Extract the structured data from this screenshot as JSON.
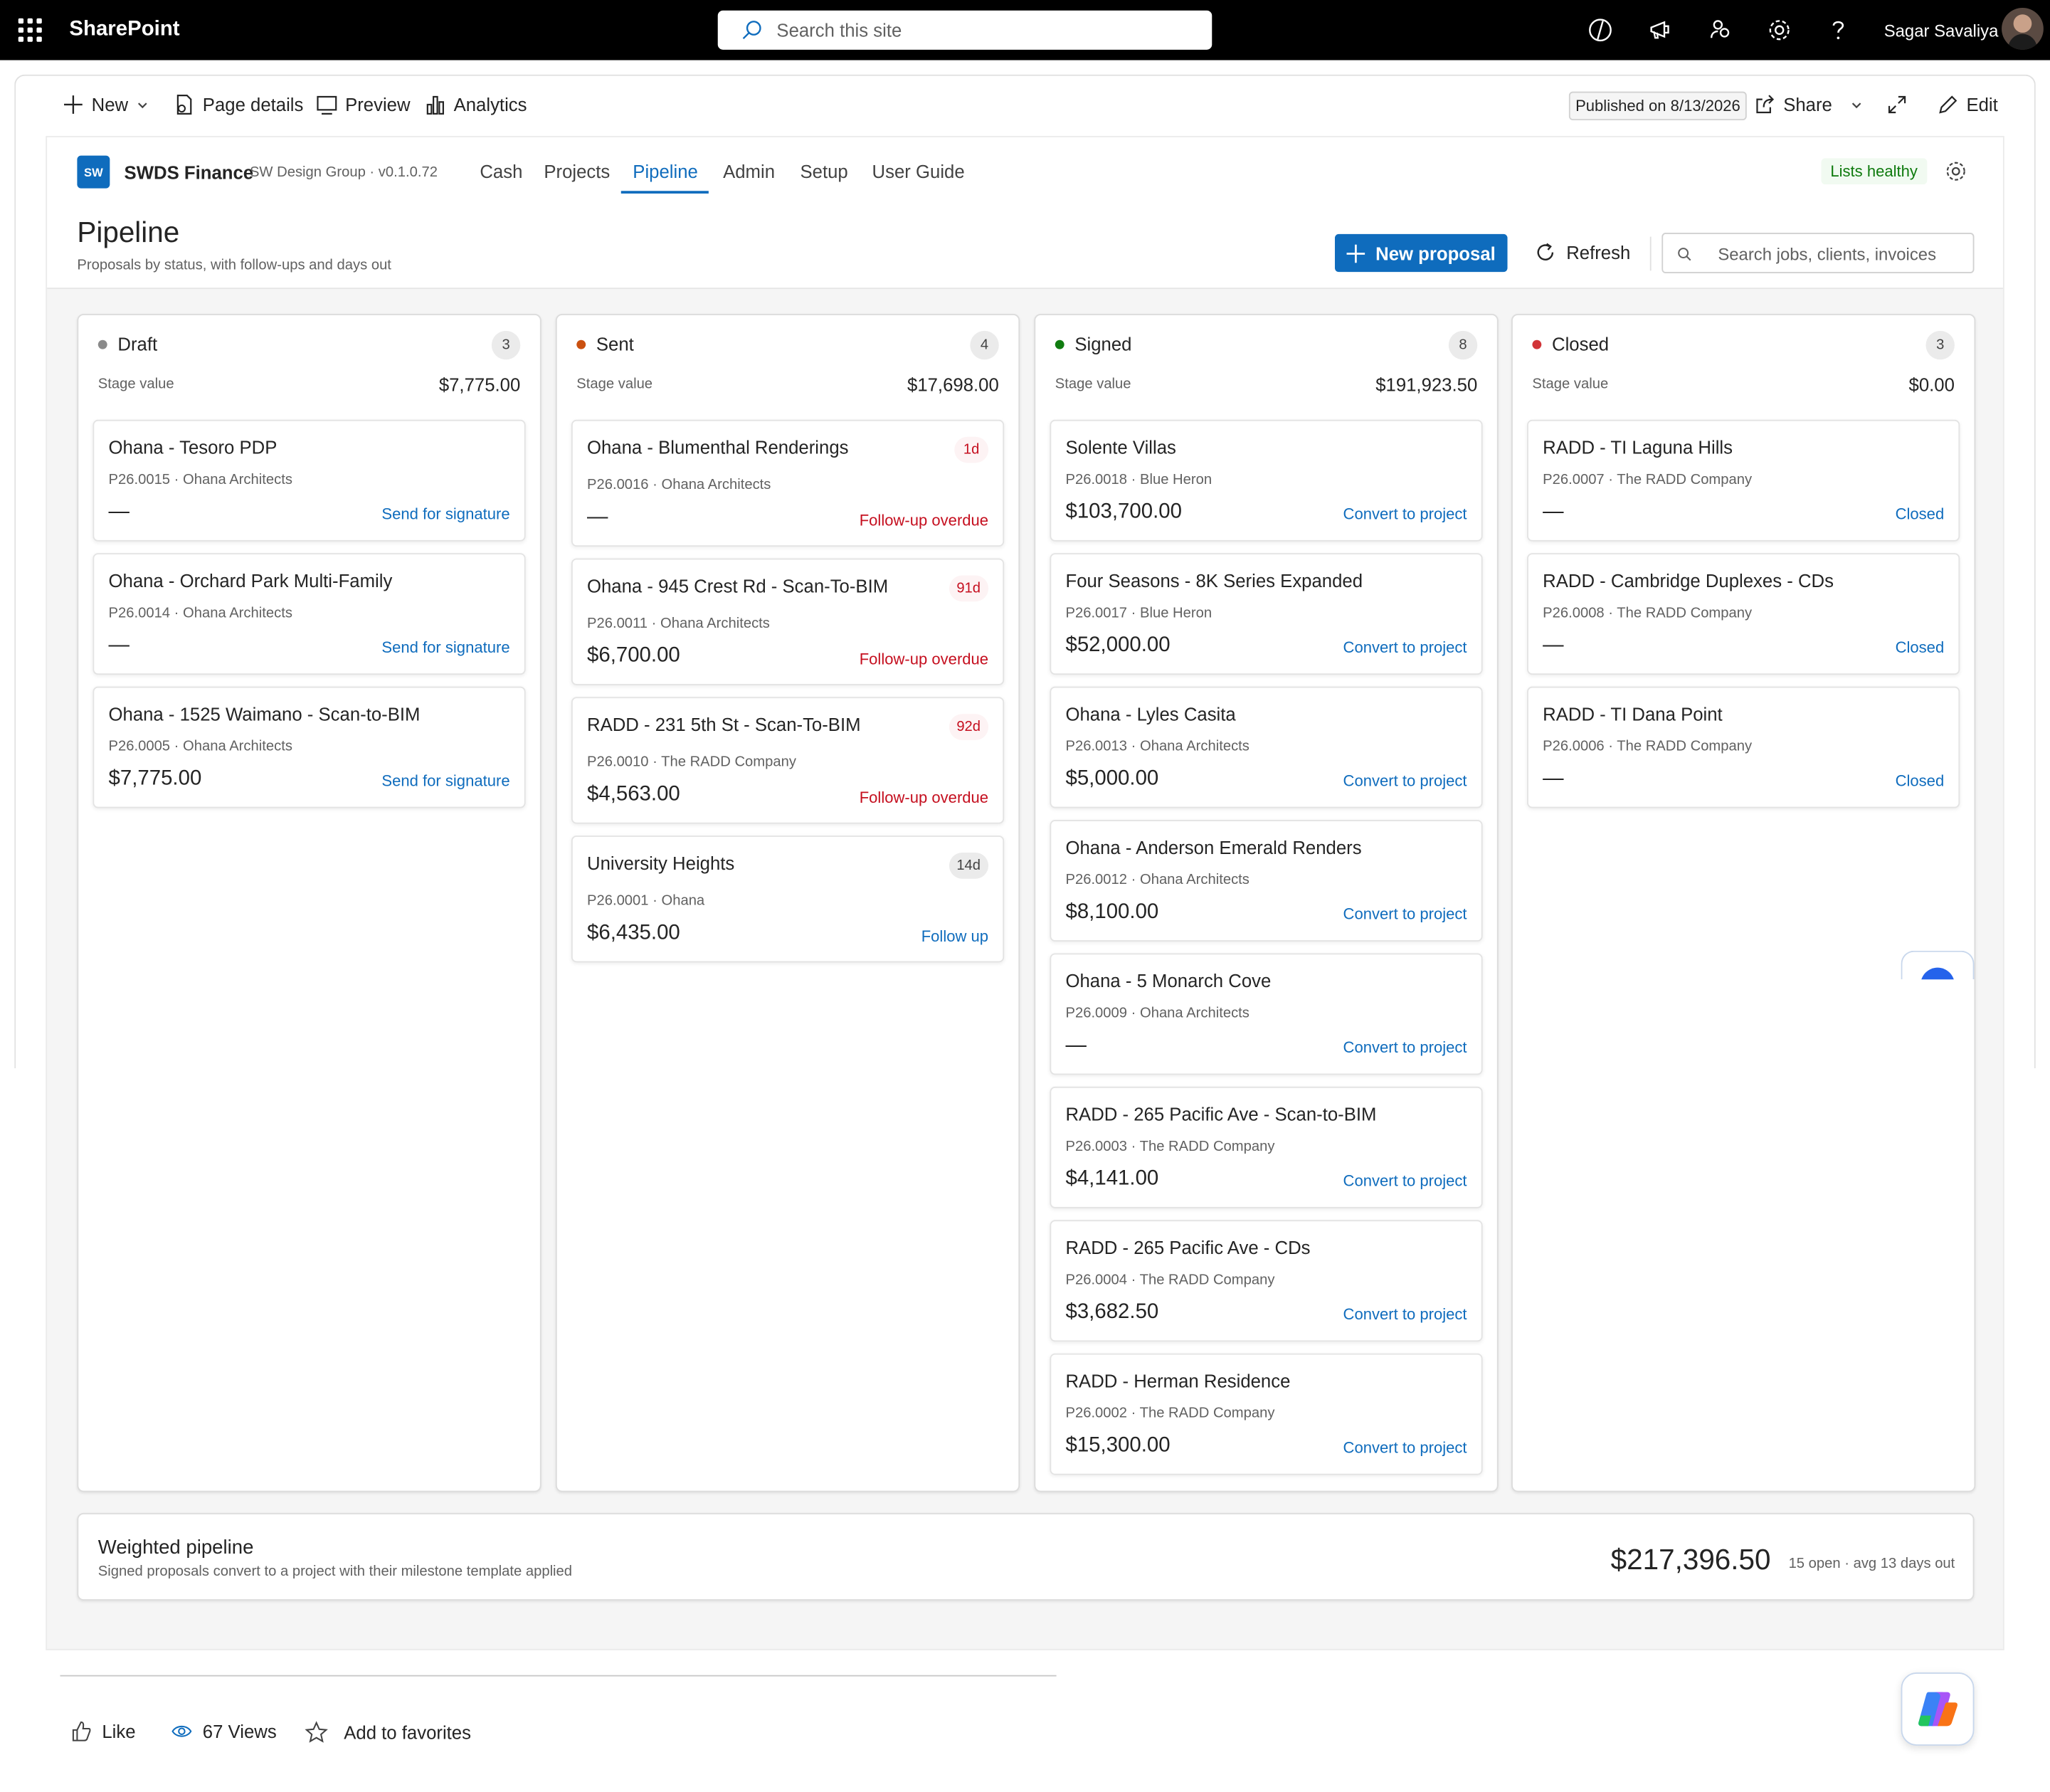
{
  "suite": {
    "brand": "SharePoint",
    "search_placeholder": "Search this site",
    "user_name": "Sagar Savaliya"
  },
  "command_bar": {
    "new_label": "New",
    "page_details_label": "Page details",
    "preview_label": "Preview",
    "analytics_label": "Analytics",
    "published_label": "Published on 8/13/2026",
    "share_label": "Share",
    "edit_label": "Edit"
  },
  "app": {
    "logo_text": "SW",
    "name": "SWDS Finance",
    "subtitle": "SW Design Group · v0.1.0.72",
    "tabs": [
      "Cash",
      "Projects",
      "Pipeline",
      "Admin",
      "Setup",
      "User Guide"
    ],
    "active_tab": "Pipeline",
    "status_badge": "Lists healthy",
    "accent_color": "#0f6cbd"
  },
  "page": {
    "title": "Pipeline",
    "subtitle": "Proposals by status, with follow-ups and days out",
    "new_proposal_label": "New proposal",
    "refresh_label": "Refresh",
    "search_placeholder": "Search jobs, clients, invoices"
  },
  "columns": [
    {
      "title": "Draft",
      "count": "3",
      "dot_color": "#8a8a8a",
      "stage_label": "Stage value",
      "stage_value": "$7,775.00",
      "cards": [
        {
          "title": "Ohana - Tesoro PDP",
          "meta": "P26.0015 · Ohana Architects",
          "amount": "—",
          "action": "Send for signature"
        },
        {
          "title": "Ohana - Orchard Park Multi-Family",
          "meta": "P26.0014 · Ohana Architects",
          "amount": "—",
          "action": "Send for signature"
        },
        {
          "title": "Ohana - 1525 Waimano - Scan-to-BIM",
          "meta": "P26.0005 · Ohana Architects",
          "amount": "$7,775.00",
          "action": "Send for signature"
        }
      ]
    },
    {
      "title": "Sent",
      "count": "4",
      "dot_color": "#ca5010",
      "stage_label": "Stage value",
      "stage_value": "$17,698.00",
      "cards": [
        {
          "title": "Ohana - Blumenthal Renderings",
          "meta": "P26.0016 · Ohana Architects",
          "amount": "—",
          "action": "Follow-up overdue",
          "badge": "1d"
        },
        {
          "title": "Ohana - 945 Crest Rd - Scan-To-BIM",
          "meta": "P26.0011 · Ohana Architects",
          "amount": "$6,700.00",
          "action": "Follow-up overdue",
          "badge": "91d"
        },
        {
          "title": "RADD - 231 5th St - Scan-To-BIM",
          "meta": "P26.0010 · The RADD Company",
          "amount": "$4,563.00",
          "action": "Follow-up overdue",
          "badge": "92d"
        },
        {
          "title": "University Heights",
          "meta": "P26.0001 · Ohana",
          "amount": "$6,435.00",
          "action": "Follow up",
          "badge": "14d"
        }
      ]
    },
    {
      "title": "Signed",
      "count": "8",
      "dot_color": "#107c10",
      "stage_label": "Stage value",
      "stage_value": "$191,923.50",
      "cards": [
        {
          "title": "Solente Villas",
          "meta": "P26.0018 · Blue Heron",
          "amount": "$103,700.00",
          "action": "Convert to project"
        },
        {
          "title": "Four Seasons - 8K Series Expanded",
          "meta": "P26.0017 · Blue Heron",
          "amount": "$52,000.00",
          "action": "Convert to project"
        },
        {
          "title": "Ohana - Lyles Casita",
          "meta": "P26.0013 · Ohana Architects",
          "amount": "$5,000.00",
          "action": "Convert to project"
        },
        {
          "title": "Ohana - Anderson Emerald Renders",
          "meta": "P26.0012 · Ohana Architects",
          "amount": "$8,100.00",
          "action": "Convert to project"
        },
        {
          "title": "Ohana - 5 Monarch Cove",
          "meta": "P26.0009 · Ohana Architects",
          "amount": "—",
          "action": "Convert to project"
        },
        {
          "title": "RADD - 265 Pacific Ave - Scan-to-BIM",
          "meta": "P26.0003 · The RADD Company",
          "amount": "$4,141.00",
          "action": "Convert to project"
        },
        {
          "title": "RADD - 265 Pacific Ave - CDs",
          "meta": "P26.0004 · The RADD Company",
          "amount": "$3,682.50",
          "action": "Convert to project"
        },
        {
          "title": "RADD - Herman Residence",
          "meta": "P26.0002 · The RADD Company",
          "amount": "$15,300.00",
          "action": "Convert to project"
        }
      ]
    },
    {
      "title": "Closed",
      "count": "3",
      "dot_color": "#d13438",
      "stage_label": "Stage value",
      "stage_value": "$0.00",
      "cards": [
        {
          "title": "RADD - TI Laguna Hills",
          "meta": "P26.0007 · The RADD Company",
          "amount": "—",
          "action": "Closed"
        },
        {
          "title": "RADD - Cambridge Duplexes - CDs",
          "meta": "P26.0008 · The RADD Company",
          "amount": "—",
          "action": "Closed"
        },
        {
          "title": "RADD - TI Dana Point",
          "meta": "P26.0006 · The RADD Company",
          "amount": "—",
          "action": "Closed"
        }
      ]
    }
  ],
  "weighted": {
    "title": "Weighted pipeline",
    "subtitle": "Signed proposals convert to a project with their milestone template applied",
    "value": "$217,396.50",
    "meta": "15 open · avg 13 days out"
  },
  "social": {
    "like_label": "Like",
    "views_label": "67 Views",
    "favorites_label": "Add to favorites"
  }
}
